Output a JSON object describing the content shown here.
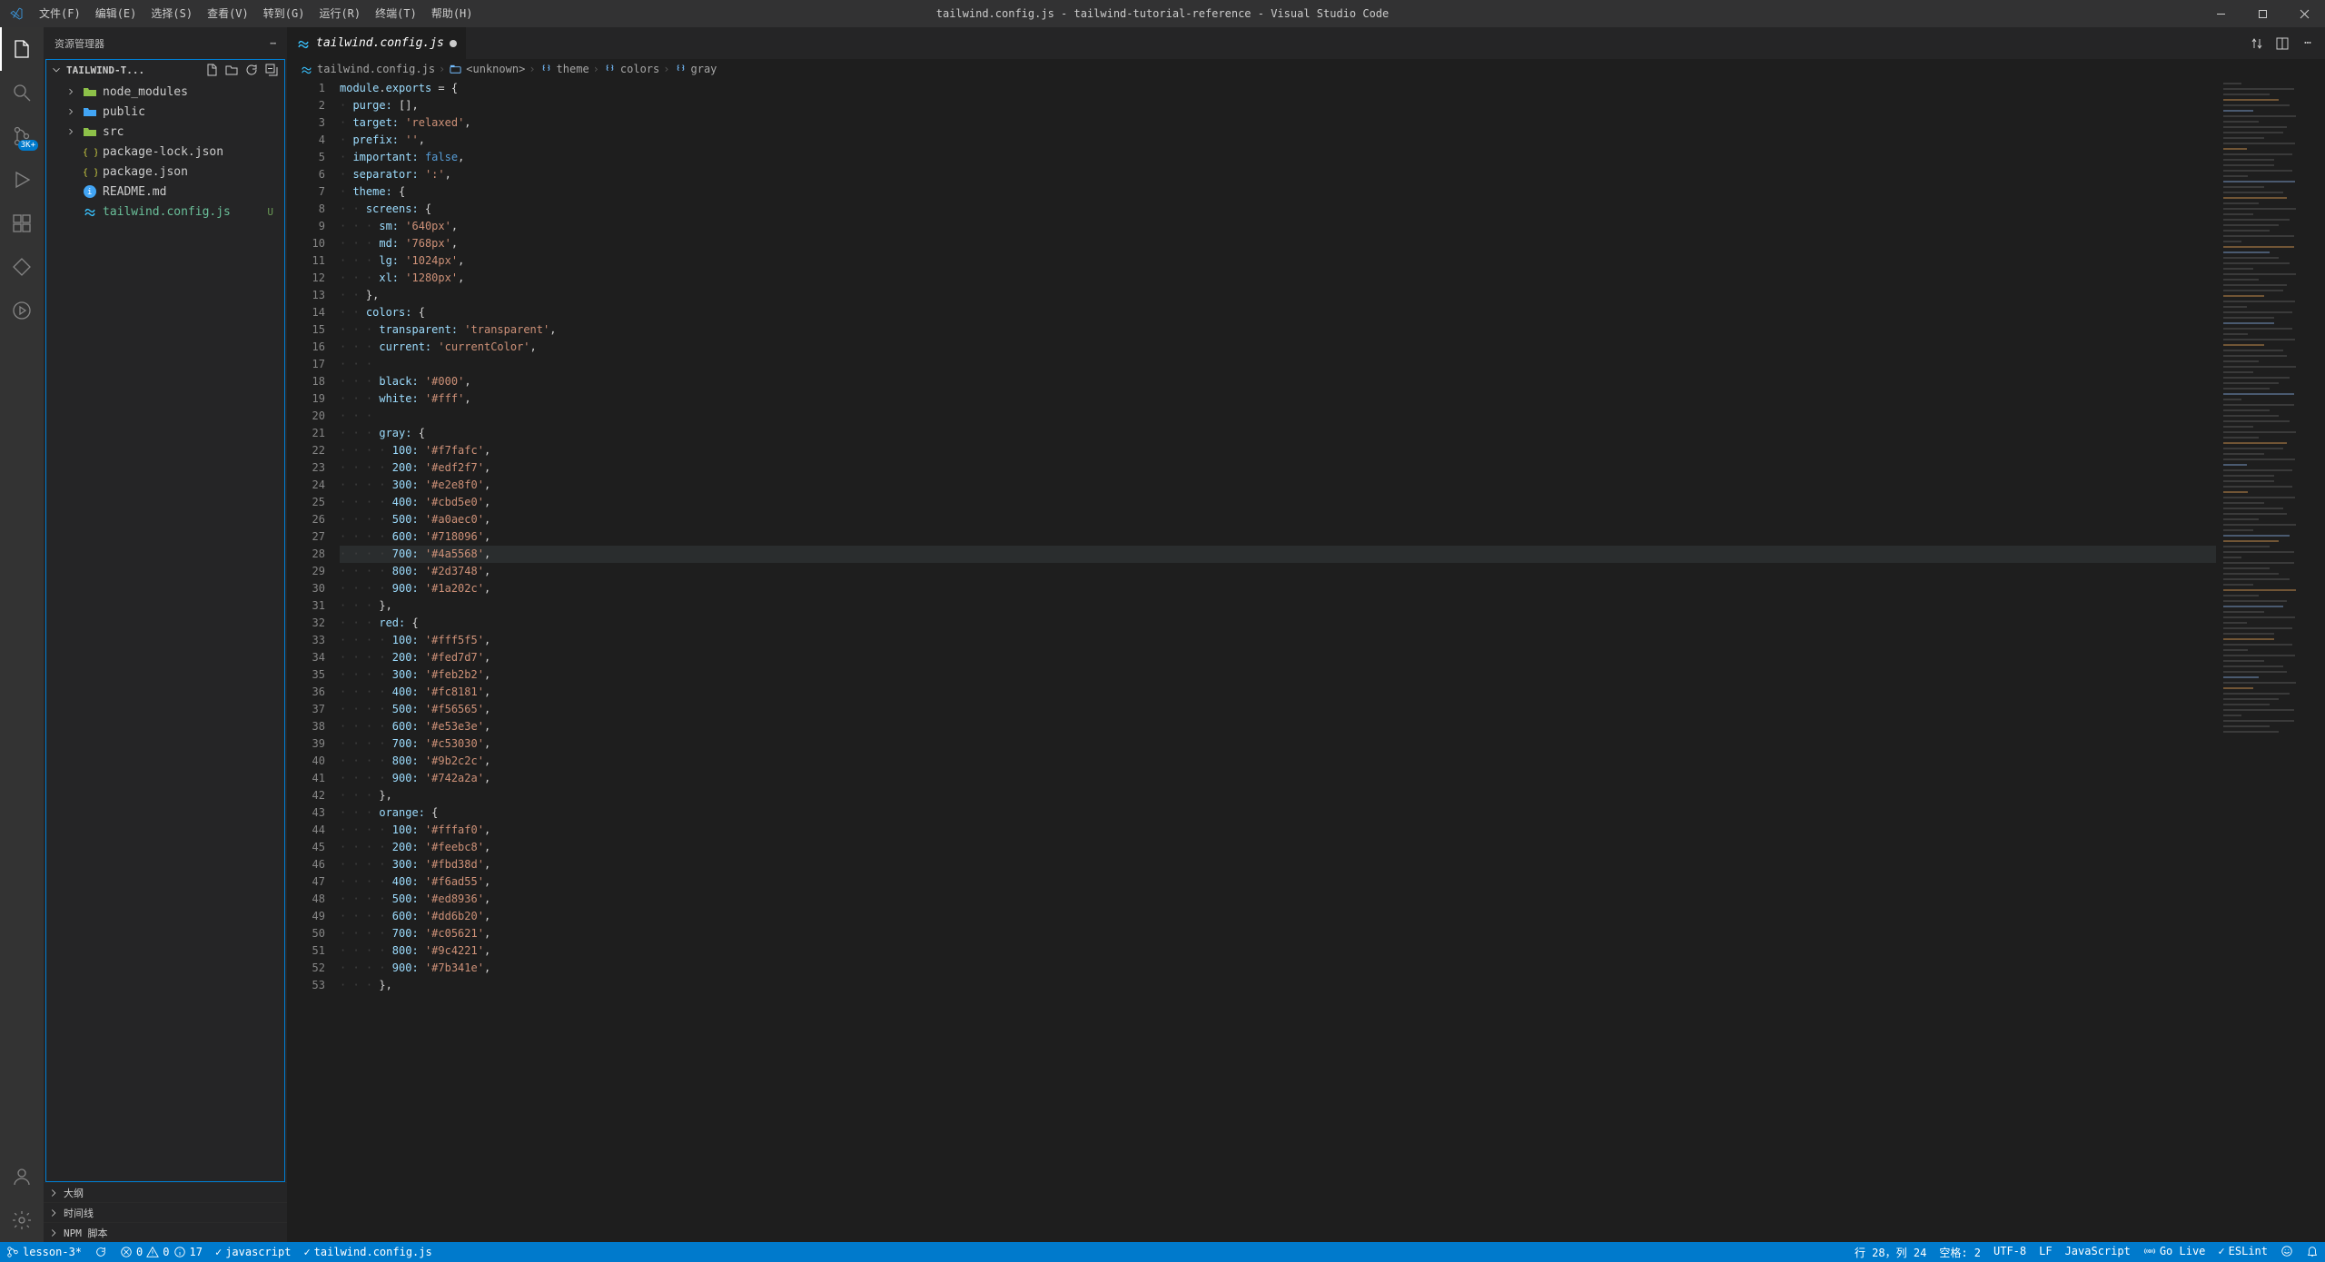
{
  "window": {
    "title": "tailwind.config.js - tailwind-tutorial-reference - Visual Studio Code",
    "menus": [
      "文件(F)",
      "编辑(E)",
      "选择(S)",
      "查看(V)",
      "转到(G)",
      "运行(R)",
      "终端(T)",
      "帮助(H)"
    ]
  },
  "activityBar": {
    "badge_scm": "3K+"
  },
  "sidebar": {
    "title": "资源管理器",
    "projectName": "TAILWIND-T...",
    "files": [
      {
        "name": "node_modules",
        "type": "folder"
      },
      {
        "name": "public",
        "type": "folder"
      },
      {
        "name": "src",
        "type": "folder"
      },
      {
        "name": "package-lock.json",
        "type": "file"
      },
      {
        "name": "package.json",
        "type": "file"
      },
      {
        "name": "README.md",
        "type": "file"
      },
      {
        "name": "tailwind.config.js",
        "type": "file",
        "decoration": "U",
        "active": true
      }
    ],
    "outline": "大纲",
    "timeline": "时间线",
    "npm": "NPM 脚本"
  },
  "tabs": {
    "active": "tailwind.config.js"
  },
  "breadcrumbs": {
    "items": [
      "tailwind.config.js",
      "<unknown>",
      "theme",
      "colors",
      "gray"
    ]
  },
  "code": {
    "lines": [
      {
        "n": 1,
        "i": 0,
        "t": [
          [
            "prop",
            "module"
          ],
          [
            "punc",
            "."
          ],
          [
            "prop",
            "exports"
          ],
          [
            "punc",
            " = {"
          ]
        ]
      },
      {
        "n": 2,
        "i": 1,
        "t": [
          [
            "prop",
            "purge:"
          ],
          [
            "punc",
            " [],"
          ]
        ]
      },
      {
        "n": 3,
        "i": 1,
        "t": [
          [
            "prop",
            "target:"
          ],
          [
            "punc",
            " "
          ],
          [
            "str",
            "'relaxed'"
          ],
          [
            "punc",
            ","
          ]
        ]
      },
      {
        "n": 4,
        "i": 1,
        "t": [
          [
            "prop",
            "prefix:"
          ],
          [
            "punc",
            " "
          ],
          [
            "str",
            "''"
          ],
          [
            "punc",
            ","
          ]
        ]
      },
      {
        "n": 5,
        "i": 1,
        "t": [
          [
            "prop",
            "important:"
          ],
          [
            "punc",
            " "
          ],
          [
            "const",
            "false"
          ],
          [
            "punc",
            ","
          ]
        ]
      },
      {
        "n": 6,
        "i": 1,
        "t": [
          [
            "prop",
            "separator:"
          ],
          [
            "punc",
            " "
          ],
          [
            "str",
            "':'"
          ],
          [
            "punc",
            ","
          ]
        ]
      },
      {
        "n": 7,
        "i": 1,
        "t": [
          [
            "prop",
            "theme:"
          ],
          [
            "punc",
            " {"
          ]
        ]
      },
      {
        "n": 8,
        "i": 2,
        "t": [
          [
            "prop",
            "screens:"
          ],
          [
            "punc",
            " {"
          ]
        ]
      },
      {
        "n": 9,
        "i": 3,
        "t": [
          [
            "prop",
            "sm:"
          ],
          [
            "punc",
            " "
          ],
          [
            "str",
            "'640px'"
          ],
          [
            "punc",
            ","
          ]
        ]
      },
      {
        "n": 10,
        "i": 3,
        "t": [
          [
            "prop",
            "md:"
          ],
          [
            "punc",
            " "
          ],
          [
            "str",
            "'768px'"
          ],
          [
            "punc",
            ","
          ]
        ]
      },
      {
        "n": 11,
        "i": 3,
        "t": [
          [
            "prop",
            "lg:"
          ],
          [
            "punc",
            " "
          ],
          [
            "str",
            "'1024px'"
          ],
          [
            "punc",
            ","
          ]
        ]
      },
      {
        "n": 12,
        "i": 3,
        "t": [
          [
            "prop",
            "xl:"
          ],
          [
            "punc",
            " "
          ],
          [
            "str",
            "'1280px'"
          ],
          [
            "punc",
            ","
          ]
        ]
      },
      {
        "n": 13,
        "i": 2,
        "t": [
          [
            "punc",
            "},"
          ]
        ]
      },
      {
        "n": 14,
        "i": 2,
        "t": [
          [
            "prop",
            "colors:"
          ],
          [
            "punc",
            " {"
          ]
        ]
      },
      {
        "n": 15,
        "i": 3,
        "t": [
          [
            "prop",
            "transparent:"
          ],
          [
            "punc",
            " "
          ],
          [
            "str",
            "'transparent'"
          ],
          [
            "punc",
            ","
          ]
        ]
      },
      {
        "n": 16,
        "i": 3,
        "t": [
          [
            "prop",
            "current:"
          ],
          [
            "punc",
            " "
          ],
          [
            "str",
            "'currentColor'"
          ],
          [
            "punc",
            ","
          ]
        ]
      },
      {
        "n": 17,
        "i": 3,
        "t": []
      },
      {
        "n": 18,
        "i": 3,
        "t": [
          [
            "prop",
            "black:"
          ],
          [
            "punc",
            " "
          ],
          [
            "str",
            "'#000'"
          ],
          [
            "punc",
            ","
          ]
        ]
      },
      {
        "n": 19,
        "i": 3,
        "t": [
          [
            "prop",
            "white:"
          ],
          [
            "punc",
            " "
          ],
          [
            "str",
            "'#fff'"
          ],
          [
            "punc",
            ","
          ]
        ]
      },
      {
        "n": 20,
        "i": 3,
        "t": []
      },
      {
        "n": 21,
        "i": 3,
        "t": [
          [
            "prop",
            "gray:"
          ],
          [
            "punc",
            " {"
          ]
        ]
      },
      {
        "n": 22,
        "i": 4,
        "t": [
          [
            "prop",
            "100:"
          ],
          [
            "punc",
            " "
          ],
          [
            "str",
            "'#f7fafc'"
          ],
          [
            "punc",
            ","
          ]
        ]
      },
      {
        "n": 23,
        "i": 4,
        "t": [
          [
            "prop",
            "200:"
          ],
          [
            "punc",
            " "
          ],
          [
            "str",
            "'#edf2f7'"
          ],
          [
            "punc",
            ","
          ]
        ]
      },
      {
        "n": 24,
        "i": 4,
        "t": [
          [
            "prop",
            "300:"
          ],
          [
            "punc",
            " "
          ],
          [
            "str",
            "'#e2e8f0'"
          ],
          [
            "punc",
            ","
          ]
        ]
      },
      {
        "n": 25,
        "i": 4,
        "t": [
          [
            "prop",
            "400:"
          ],
          [
            "punc",
            " "
          ],
          [
            "str",
            "'#cbd5e0'"
          ],
          [
            "punc",
            ","
          ]
        ]
      },
      {
        "n": 26,
        "i": 4,
        "t": [
          [
            "prop",
            "500:"
          ],
          [
            "punc",
            " "
          ],
          [
            "str",
            "'#a0aec0'"
          ],
          [
            "punc",
            ","
          ]
        ]
      },
      {
        "n": 27,
        "i": 4,
        "t": [
          [
            "prop",
            "600:"
          ],
          [
            "punc",
            " "
          ],
          [
            "str",
            "'#718096'"
          ],
          [
            "punc",
            ","
          ]
        ]
      },
      {
        "n": 28,
        "i": 4,
        "hl": true,
        "t": [
          [
            "prop",
            "700:"
          ],
          [
            "punc",
            " "
          ],
          [
            "str",
            "'#4a5568'"
          ],
          [
            "punc",
            ","
          ]
        ]
      },
      {
        "n": 29,
        "i": 4,
        "t": [
          [
            "prop",
            "800:"
          ],
          [
            "punc",
            " "
          ],
          [
            "str",
            "'#2d3748'"
          ],
          [
            "punc",
            ","
          ]
        ]
      },
      {
        "n": 30,
        "i": 4,
        "t": [
          [
            "prop",
            "900:"
          ],
          [
            "punc",
            " "
          ],
          [
            "str",
            "'#1a202c'"
          ],
          [
            "punc",
            ","
          ]
        ]
      },
      {
        "n": 31,
        "i": 3,
        "t": [
          [
            "punc",
            "},"
          ]
        ]
      },
      {
        "n": 32,
        "i": 3,
        "t": [
          [
            "prop",
            "red:"
          ],
          [
            "punc",
            " {"
          ]
        ]
      },
      {
        "n": 33,
        "i": 4,
        "t": [
          [
            "prop",
            "100:"
          ],
          [
            "punc",
            " "
          ],
          [
            "str",
            "'#fff5f5'"
          ],
          [
            "punc",
            ","
          ]
        ]
      },
      {
        "n": 34,
        "i": 4,
        "t": [
          [
            "prop",
            "200:"
          ],
          [
            "punc",
            " "
          ],
          [
            "str",
            "'#fed7d7'"
          ],
          [
            "punc",
            ","
          ]
        ]
      },
      {
        "n": 35,
        "i": 4,
        "t": [
          [
            "prop",
            "300:"
          ],
          [
            "punc",
            " "
          ],
          [
            "str",
            "'#feb2b2'"
          ],
          [
            "punc",
            ","
          ]
        ]
      },
      {
        "n": 36,
        "i": 4,
        "t": [
          [
            "prop",
            "400:"
          ],
          [
            "punc",
            " "
          ],
          [
            "str",
            "'#fc8181'"
          ],
          [
            "punc",
            ","
          ]
        ]
      },
      {
        "n": 37,
        "i": 4,
        "t": [
          [
            "prop",
            "500:"
          ],
          [
            "punc",
            " "
          ],
          [
            "str",
            "'#f56565'"
          ],
          [
            "punc",
            ","
          ]
        ]
      },
      {
        "n": 38,
        "i": 4,
        "t": [
          [
            "prop",
            "600:"
          ],
          [
            "punc",
            " "
          ],
          [
            "str",
            "'#e53e3e'"
          ],
          [
            "punc",
            ","
          ]
        ]
      },
      {
        "n": 39,
        "i": 4,
        "t": [
          [
            "prop",
            "700:"
          ],
          [
            "punc",
            " "
          ],
          [
            "str",
            "'#c53030'"
          ],
          [
            "punc",
            ","
          ]
        ]
      },
      {
        "n": 40,
        "i": 4,
        "t": [
          [
            "prop",
            "800:"
          ],
          [
            "punc",
            " "
          ],
          [
            "str",
            "'#9b2c2c'"
          ],
          [
            "punc",
            ","
          ]
        ]
      },
      {
        "n": 41,
        "i": 4,
        "t": [
          [
            "prop",
            "900:"
          ],
          [
            "punc",
            " "
          ],
          [
            "str",
            "'#742a2a'"
          ],
          [
            "punc",
            ","
          ]
        ]
      },
      {
        "n": 42,
        "i": 3,
        "t": [
          [
            "punc",
            "},"
          ]
        ]
      },
      {
        "n": 43,
        "i": 3,
        "t": [
          [
            "prop",
            "orange:"
          ],
          [
            "punc",
            " {"
          ]
        ]
      },
      {
        "n": 44,
        "i": 4,
        "t": [
          [
            "prop",
            "100:"
          ],
          [
            "punc",
            " "
          ],
          [
            "str",
            "'#fffaf0'"
          ],
          [
            "punc",
            ","
          ]
        ]
      },
      {
        "n": 45,
        "i": 4,
        "t": [
          [
            "prop",
            "200:"
          ],
          [
            "punc",
            " "
          ],
          [
            "str",
            "'#feebc8'"
          ],
          [
            "punc",
            ","
          ]
        ]
      },
      {
        "n": 46,
        "i": 4,
        "t": [
          [
            "prop",
            "300:"
          ],
          [
            "punc",
            " "
          ],
          [
            "str",
            "'#fbd38d'"
          ],
          [
            "punc",
            ","
          ]
        ]
      },
      {
        "n": 47,
        "i": 4,
        "t": [
          [
            "prop",
            "400:"
          ],
          [
            "punc",
            " "
          ],
          [
            "str",
            "'#f6ad55'"
          ],
          [
            "punc",
            ","
          ]
        ]
      },
      {
        "n": 48,
        "i": 4,
        "t": [
          [
            "prop",
            "500:"
          ],
          [
            "punc",
            " "
          ],
          [
            "str",
            "'#ed8936'"
          ],
          [
            "punc",
            ","
          ]
        ]
      },
      {
        "n": 49,
        "i": 4,
        "t": [
          [
            "prop",
            "600:"
          ],
          [
            "punc",
            " "
          ],
          [
            "str",
            "'#dd6b20'"
          ],
          [
            "punc",
            ","
          ]
        ]
      },
      {
        "n": 50,
        "i": 4,
        "t": [
          [
            "prop",
            "700:"
          ],
          [
            "punc",
            " "
          ],
          [
            "str",
            "'#c05621'"
          ],
          [
            "punc",
            ","
          ]
        ]
      },
      {
        "n": 51,
        "i": 4,
        "t": [
          [
            "prop",
            "800:"
          ],
          [
            "punc",
            " "
          ],
          [
            "str",
            "'#9c4221'"
          ],
          [
            "punc",
            ","
          ]
        ]
      },
      {
        "n": 52,
        "i": 4,
        "t": [
          [
            "prop",
            "900:"
          ],
          [
            "punc",
            " "
          ],
          [
            "str",
            "'#7b341e'"
          ],
          [
            "punc",
            ","
          ]
        ]
      },
      {
        "n": 53,
        "i": 3,
        "t": [
          [
            "punc",
            "},"
          ]
        ]
      }
    ]
  },
  "statusBar": {
    "branch": "lesson-3*",
    "problems_err": "0",
    "problems_warn": "0",
    "problems_info": "17",
    "checks": [
      "javascript",
      "tailwind.config.js"
    ],
    "ln_col": "行 28，列 24",
    "spaces": "空格: 2",
    "encoding": "UTF-8",
    "eol": "LF",
    "lang": "JavaScript",
    "golive": "Go Live",
    "eslint": "ESLint"
  }
}
